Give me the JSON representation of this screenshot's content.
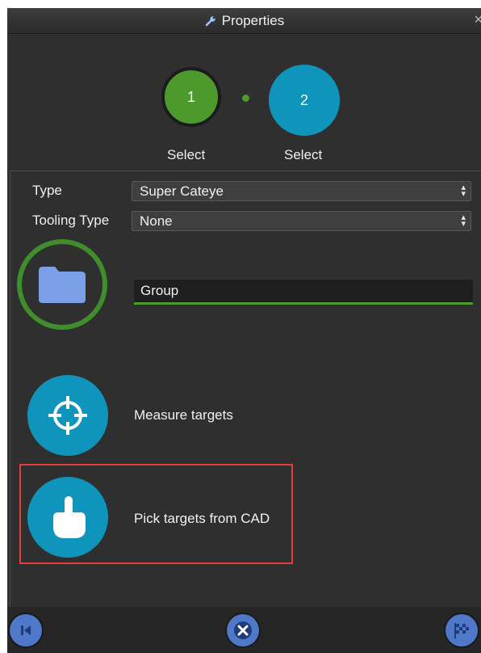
{
  "window": {
    "title": "Properties",
    "close_glyph": "×"
  },
  "steps": [
    {
      "number": "1",
      "label": "Select",
      "state": "done",
      "color": "#4c9a2c"
    },
    {
      "number": "2",
      "label": "Select",
      "state": "active",
      "color": "#0f95bb"
    }
  ],
  "form": {
    "type_label": "Type",
    "type_value": "Super Cateye",
    "tooling_label": "Tooling Type",
    "tooling_value": "None",
    "group_name": "Group"
  },
  "actions": {
    "measure_label": "Measure targets",
    "pick_label": "Pick targets from CAD"
  },
  "footer": {
    "icons": [
      "previous-icon",
      "cancel-icon",
      "finish-flag-icon"
    ]
  },
  "colors": {
    "accent_green": "#4c9a2c",
    "accent_blue": "#0f95bb",
    "highlight_red": "#e43d3d",
    "footer_button": "#4f78c8"
  }
}
